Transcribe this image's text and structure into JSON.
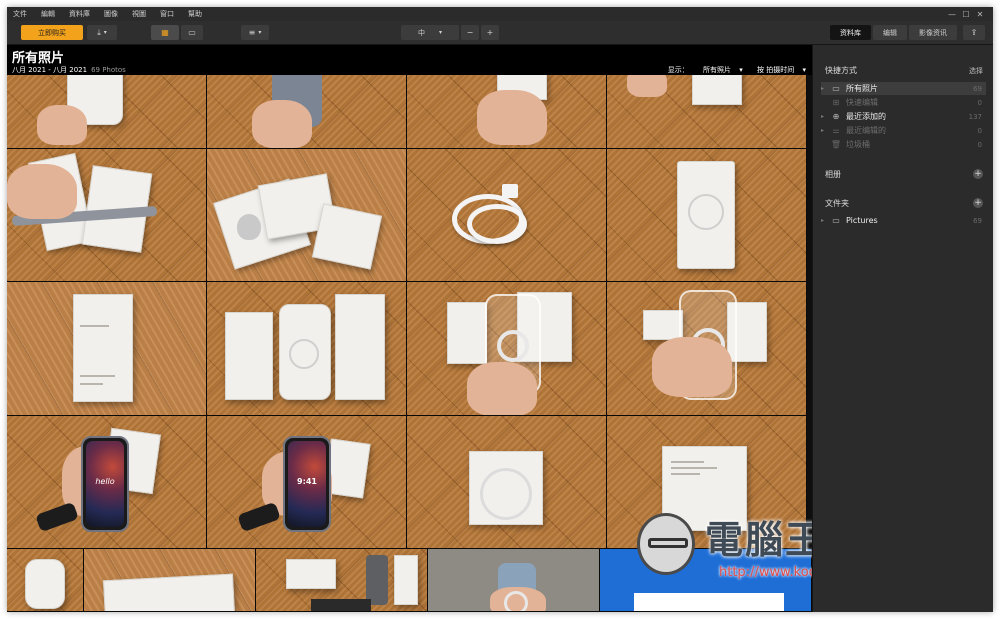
{
  "menu": [
    "文件",
    "編輯",
    "資料庫",
    "圖像",
    "視圖",
    "窗口",
    "幫助"
  ],
  "window_controls": [
    "—",
    "☐",
    "✕"
  ],
  "toolbar": {
    "buy_label": "立即购买",
    "zoom_label": "中",
    "tabs": [
      {
        "label": "资料库",
        "active": true
      },
      {
        "label": "编辑",
        "active": false
      },
      {
        "label": "影像资讯",
        "active": false
      }
    ]
  },
  "library": {
    "title": "所有照片",
    "date_range": "八月 2021 - 八月 2021",
    "photo_count": "69 Photos",
    "show_label": "显示：",
    "show_value": "所有照片",
    "sort_label": "按 拍摄时间"
  },
  "sidebar": {
    "quick_header": "快捷方式",
    "quick_action": "选择",
    "quick_items": [
      {
        "label": "所有照片",
        "count": "69",
        "dim": false,
        "selected": true,
        "icon": "▭"
      },
      {
        "label": "快速编辑",
        "count": "0",
        "dim": true,
        "selected": false,
        "icon": "⊞"
      },
      {
        "label": "最近添加的",
        "count": "137",
        "dim": false,
        "selected": false,
        "icon": "⊕"
      },
      {
        "label": "最近编辑的",
        "count": "0",
        "dim": true,
        "selected": false,
        "icon": "⚌"
      },
      {
        "label": "垃圾桶",
        "count": "0",
        "dim": true,
        "selected": false,
        "icon": "🗑"
      }
    ],
    "albums_header": "相册",
    "folders_header": "文件夹",
    "folder_items": [
      {
        "label": "Pictures",
        "count": "69"
      }
    ]
  },
  "thumbnails": {
    "phone_screen_text": "hello",
    "phone_time_text": "9:41"
  },
  "watermark": {
    "site_name": "電腦王阿達",
    "url": "http://www.kocpc.com.tw"
  }
}
